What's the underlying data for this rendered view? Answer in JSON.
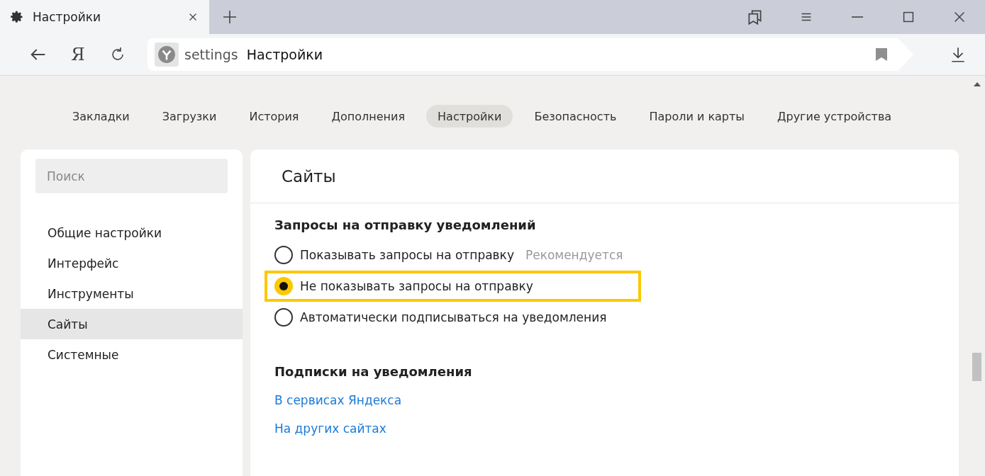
{
  "browser_tab": {
    "title": "Настройки",
    "selected": true
  },
  "toolbar": {
    "home_label": "Я",
    "address_scheme": "settings",
    "address_title": "Настройки"
  },
  "nav": [
    {
      "label": "Закладки",
      "selected": false
    },
    {
      "label": "Загрузки",
      "selected": false
    },
    {
      "label": "История",
      "selected": false
    },
    {
      "label": "Дополнения",
      "selected": false
    },
    {
      "label": "Настройки",
      "selected": true
    },
    {
      "label": "Безопасность",
      "selected": false
    },
    {
      "label": "Пароли и карты",
      "selected": false
    },
    {
      "label": "Другие устройства",
      "selected": false
    }
  ],
  "sidebar": {
    "search": {
      "placeholder": "Поиск"
    },
    "items": [
      {
        "label": "Общие настройки",
        "selected": false
      },
      {
        "label": "Интерфейс",
        "selected": false
      },
      {
        "label": "Инструменты",
        "selected": false
      },
      {
        "label": "Сайты",
        "selected": true
      },
      {
        "label": "Системные",
        "selected": false
      }
    ]
  },
  "main": {
    "title": "Сайты",
    "sections": [
      {
        "heading": "Запросы на отправку уведомлений",
        "options": [
          {
            "label": "Показывать запросы на отправку",
            "note": "Рекомендуется",
            "selected": false,
            "highlighted": false
          },
          {
            "label": "Не показывать запросы на отправку",
            "selected": true,
            "highlighted": true
          },
          {
            "label": "Автоматически подписываться на уведомления",
            "selected": false,
            "highlighted": false
          }
        ]
      },
      {
        "heading": "Подписки на уведомления",
        "links": [
          "В сервисах Яндекса",
          "На других сайтах"
        ]
      }
    ]
  }
}
